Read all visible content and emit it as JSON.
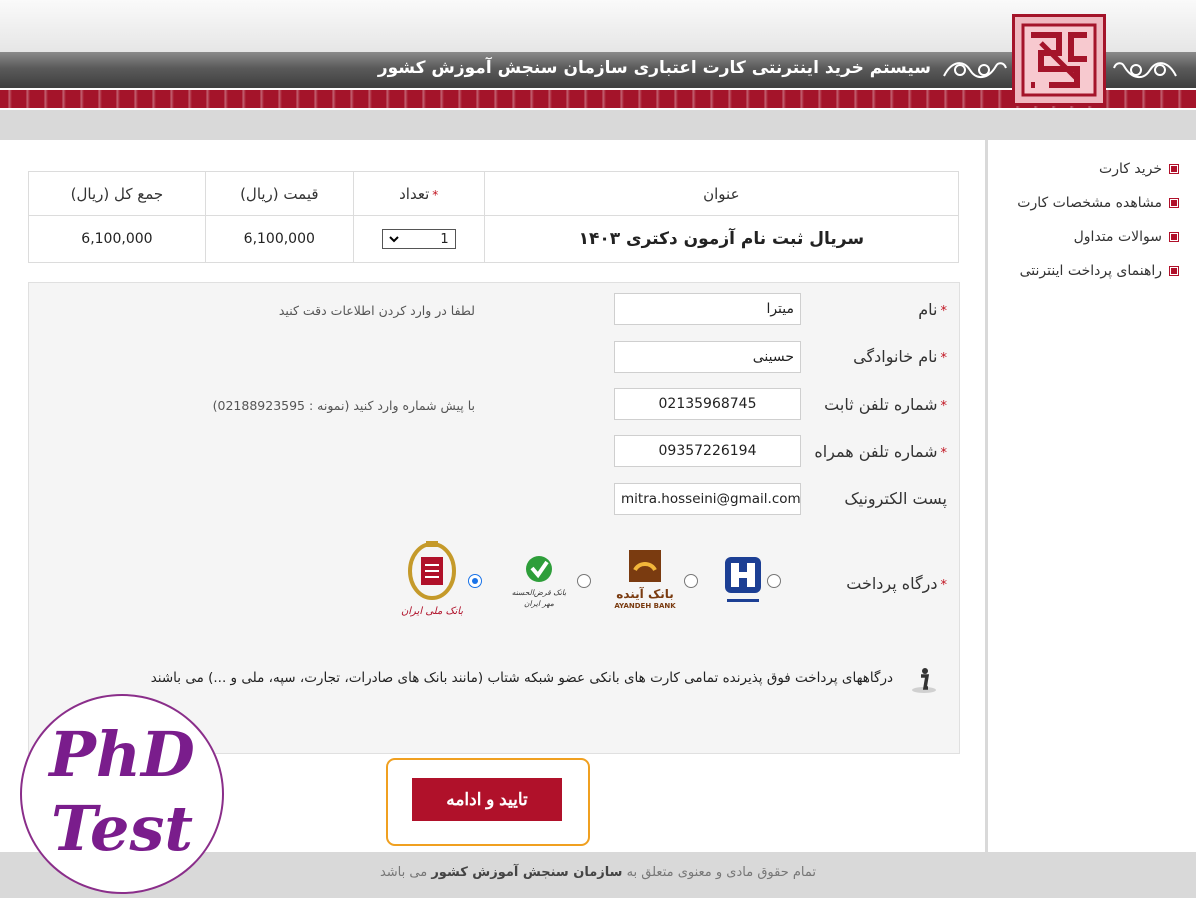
{
  "header": {
    "title": "سیستم خرید اینترنتی کارت اعتباری سازمان سنجش آموزش کشور"
  },
  "sidebar": {
    "items": [
      {
        "label": "خرید کارت"
      },
      {
        "label": "مشاهده مشخصات کارت"
      },
      {
        "label": "سوالات متداول"
      },
      {
        "label": "راهنمای پرداخت اینترنتی"
      }
    ]
  },
  "product_table": {
    "headers": {
      "title": "عنوان",
      "quantity": "تعداد",
      "price": "قیمت (ریال)",
      "total": "جمع کل (ریال)"
    },
    "row": {
      "title": "سریال ثبت نام آزمون دکتری ۱۴۰۳",
      "quantity": "1",
      "price": "6,100,000",
      "total": "6,100,000"
    }
  },
  "form": {
    "first_name": {
      "label": "نام",
      "value": "میترا",
      "hint": "لطفا در وارد کردن اطلاعات دقت کنید"
    },
    "last_name": {
      "label": "نام خانوادگی",
      "value": "حسینی"
    },
    "phone": {
      "label": "شماره تلفن ثابت",
      "value": "02135968745",
      "hint": "با پیش شماره وارد کنید (نمونه : 02188923595)"
    },
    "mobile": {
      "label": "شماره تلفن همراه",
      "value": "09357226194"
    },
    "email": {
      "label": "پست الکترونیک",
      "value": "mitra.hosseini@gmail.com"
    },
    "gateway": {
      "label": "درگاه پرداخت",
      "options": [
        {
          "name": "saderat",
          "selected": false
        },
        {
          "name": "ayandeh",
          "label_fa": "بانک آینده",
          "label_en": "AYANDEH BANK",
          "selected": false
        },
        {
          "name": "qarzolhasane-mehr-iran",
          "label_fa": "بانک قرض‌الحسنه مهر ایران",
          "selected": false
        },
        {
          "name": "melli",
          "label_fa": "بانک ملی ایران",
          "selected": true
        }
      ]
    },
    "info_text": "درگاههای پرداخت فوق پذیرنده تمامی کارت های بانکی عضو شبکه شتاب (مانند بانک های صادرات، تجارت، سپه، ملی و ...) می باشند"
  },
  "submit": {
    "label": "تایید و ادامه"
  },
  "footer": {
    "before": "تمام حقوق مادی و معنوی متعلق به",
    "org": "سازمان سنجش آموزش کشور",
    "after": "می باشد"
  },
  "watermark": {
    "line1": "PhD",
    "line2": "Test"
  },
  "colors": {
    "accent": "#b0112a",
    "highlight": "#f0a020",
    "watermark": "#7a1d8c"
  }
}
